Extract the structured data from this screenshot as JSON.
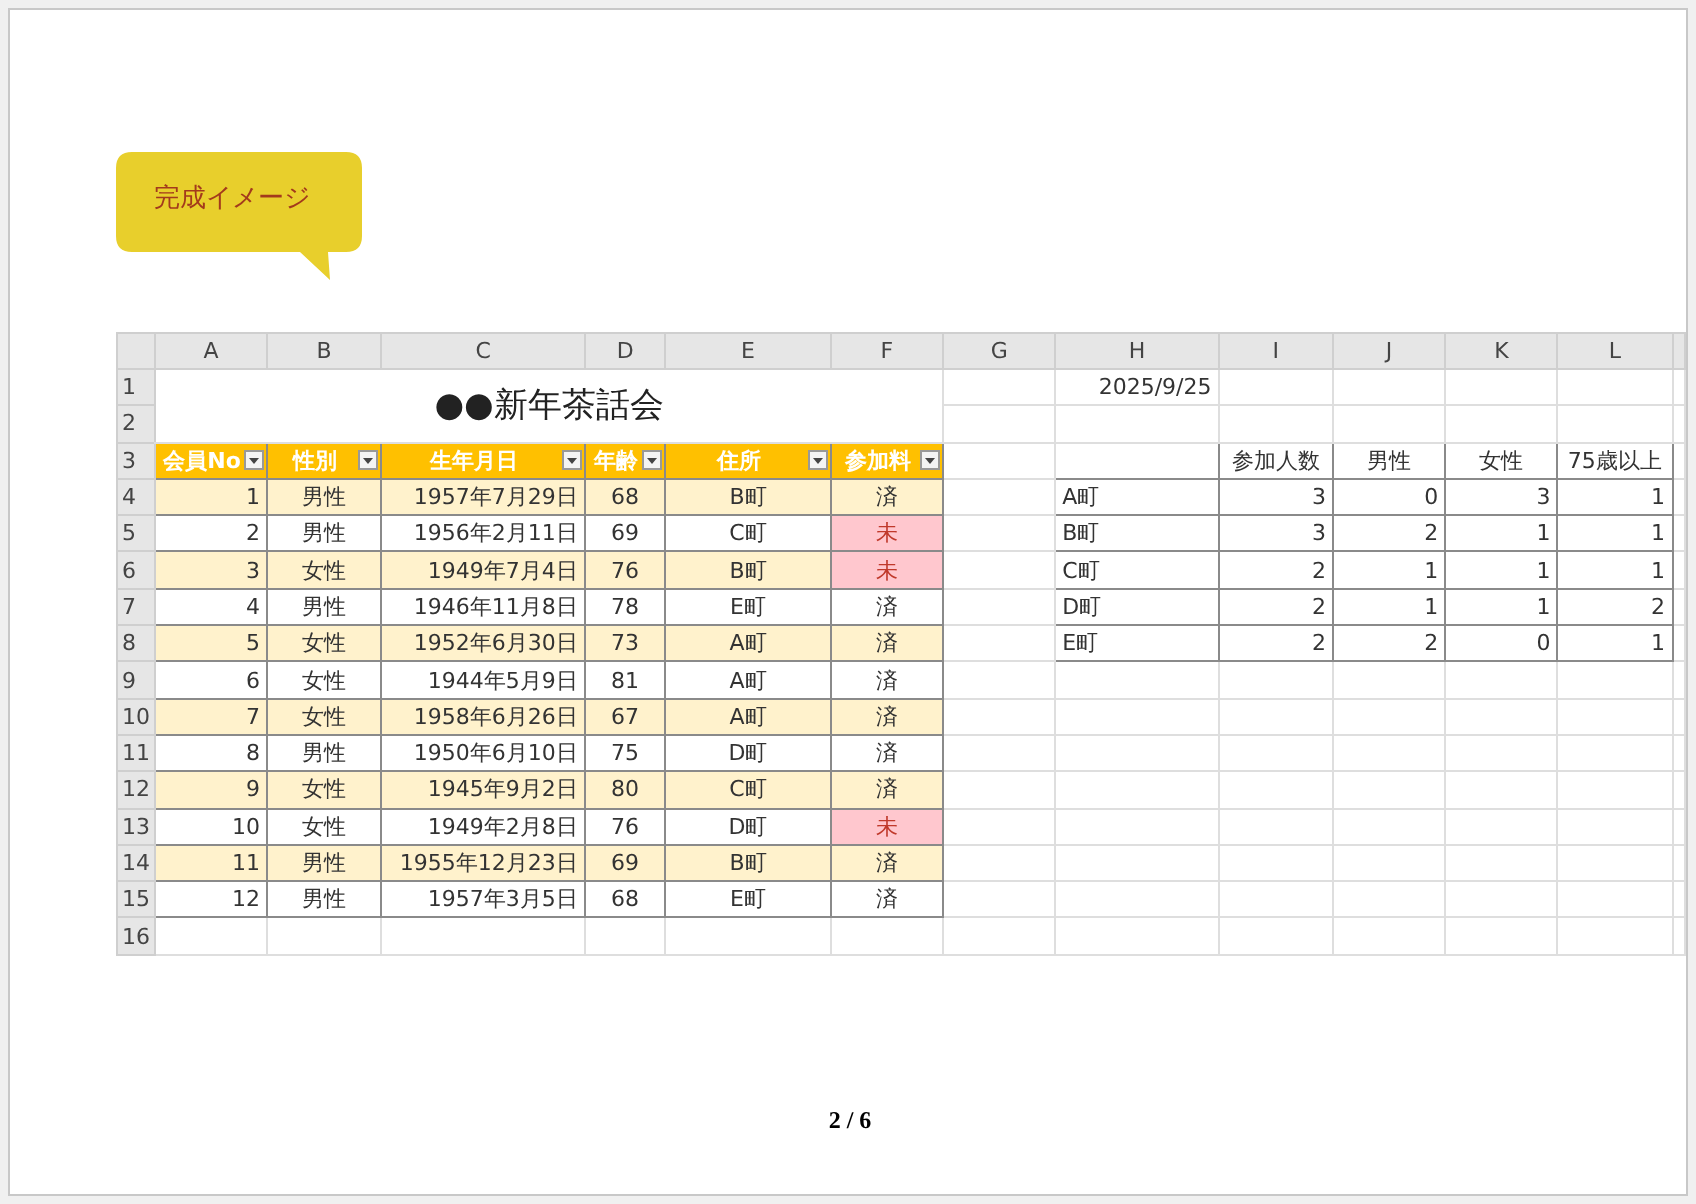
{
  "callout": {
    "text": "完成イメージ"
  },
  "sheet": {
    "column_headers": [
      "A",
      "B",
      "C",
      "D",
      "E",
      "F",
      "G",
      "H",
      "I",
      "J",
      "K",
      "L"
    ],
    "row_numbers": [
      "1",
      "2",
      "3",
      "4",
      "5",
      "6",
      "7",
      "8",
      "9",
      "10",
      "11",
      "12",
      "13",
      "14",
      "15",
      "16"
    ],
    "title": "●●新年茶話会",
    "date": "2025/9/25",
    "members": {
      "columns": [
        "会員No",
        "性別",
        "生年月日",
        "年齢",
        "住所",
        "参加料"
      ],
      "rows": [
        {
          "cells": [
            "1",
            "男性",
            "1957年7月29日",
            "68",
            "B町",
            "済"
          ],
          "flagged": false
        },
        {
          "cells": [
            "2",
            "男性",
            "1956年2月11日",
            "69",
            "C町",
            "未"
          ],
          "flagged": true
        },
        {
          "cells": [
            "3",
            "女性",
            "1949年7月4日",
            "76",
            "B町",
            "未"
          ],
          "flagged": true
        },
        {
          "cells": [
            "4",
            "男性",
            "1946年11月8日",
            "78",
            "E町",
            "済"
          ],
          "flagged": false
        },
        {
          "cells": [
            "5",
            "女性",
            "1952年6月30日",
            "73",
            "A町",
            "済"
          ],
          "flagged": false
        },
        {
          "cells": [
            "6",
            "女性",
            "1944年5月9日",
            "81",
            "A町",
            "済"
          ],
          "flagged": false
        },
        {
          "cells": [
            "7",
            "女性",
            "1958年6月26日",
            "67",
            "A町",
            "済"
          ],
          "flagged": false
        },
        {
          "cells": [
            "8",
            "男性",
            "1950年6月10日",
            "75",
            "D町",
            "済"
          ],
          "flagged": false
        },
        {
          "cells": [
            "9",
            "女性",
            "1945年9月2日",
            "80",
            "C町",
            "済"
          ],
          "flagged": false
        },
        {
          "cells": [
            "10",
            "女性",
            "1949年2月8日",
            "76",
            "D町",
            "未"
          ],
          "flagged": true
        },
        {
          "cells": [
            "11",
            "男性",
            "1955年12月23日",
            "69",
            "B町",
            "済"
          ],
          "flagged": false
        },
        {
          "cells": [
            "12",
            "男性",
            "1957年3月5日",
            "68",
            "E町",
            "済"
          ],
          "flagged": false
        }
      ]
    },
    "summary": {
      "columns": [
        "参加人数",
        "男性",
        "女性",
        "75歳以上"
      ],
      "rows": [
        {
          "town": "A町",
          "values": [
            "3",
            "0",
            "3",
            "1"
          ]
        },
        {
          "town": "B町",
          "values": [
            "3",
            "2",
            "1",
            "1"
          ]
        },
        {
          "town": "C町",
          "values": [
            "2",
            "1",
            "1",
            "1"
          ]
        },
        {
          "town": "D町",
          "values": [
            "2",
            "1",
            "1",
            "2"
          ]
        },
        {
          "town": "E町",
          "values": [
            "2",
            "2",
            "0",
            "1"
          ]
        }
      ]
    }
  },
  "page_number": "2 / 6"
}
